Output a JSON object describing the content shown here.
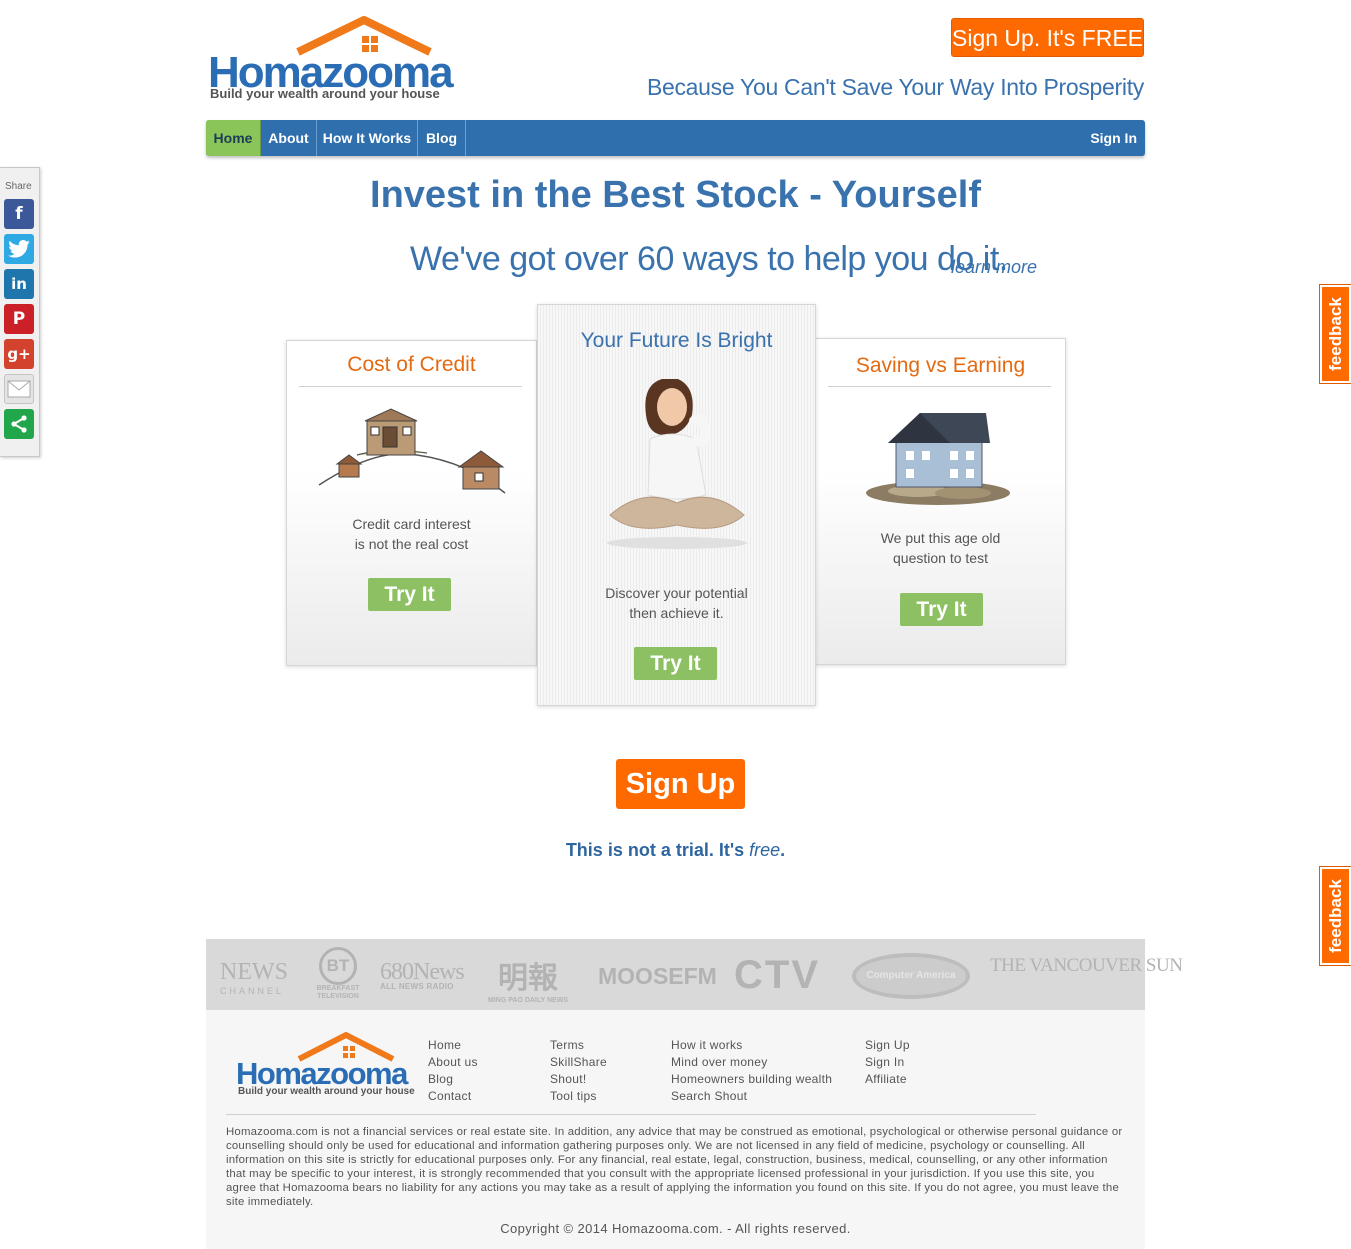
{
  "header": {
    "logo_word": "Homazooma",
    "logo_tagline": "Build your wealth around your house",
    "signup_label": "Sign Up. It's FREE",
    "tagline": "Because You Can't Save Your Way Into Prosperity"
  },
  "nav": {
    "items": [
      "Home",
      "About",
      "How It Works",
      "Blog"
    ],
    "active": "Home",
    "signin": "Sign In"
  },
  "share": {
    "label": "Share",
    "buttons": [
      {
        "name": "facebook",
        "glyph": "f",
        "color": "#3b5998"
      },
      {
        "name": "twitter",
        "glyph": "t",
        "color": "#2fa9e3"
      },
      {
        "name": "linkedin",
        "glyph": "in",
        "color": "#1f76ad"
      },
      {
        "name": "pinterest",
        "glyph": "P",
        "color": "#cb2027"
      },
      {
        "name": "google-plus",
        "glyph": "g+",
        "color": "#d2422c"
      },
      {
        "name": "email",
        "glyph": "✉",
        "color": "#c8c8c8"
      },
      {
        "name": "share-more",
        "glyph": "<",
        "color": "#22a64b"
      }
    ]
  },
  "feedback": {
    "label": "feedback"
  },
  "hero": {
    "title": "Invest in the Best Stock - Yourself",
    "subtitle": "We've got over 60 ways to help you do it.",
    "learn_more": "learn more"
  },
  "cards": {
    "left": {
      "title": "Cost of Credit",
      "line1": "Credit card interest",
      "line2": "is not the real cost",
      "button": "Try It",
      "icon": "houses-hill-illustration"
    },
    "center": {
      "title": "Your Future Is Bright",
      "line1": "Discover your potential",
      "line2": "then achieve it.",
      "button": "Try It",
      "icon": "woman-thinking-photo"
    },
    "right": {
      "title": "Saving vs Earning",
      "line1": "We put this age old",
      "line2": "question to test",
      "button": "Try It",
      "icon": "house-on-coins-photo"
    }
  },
  "signup": {
    "button": "Sign Up",
    "note_main": "This is not a trial. It's ",
    "note_em": "free",
    "note_end": "."
  },
  "media": {
    "logos": [
      "NEWS",
      "CHANNEL",
      "BT",
      "BREAKFAST TELEVISION",
      "680News",
      "ALL NEWS RADIO",
      "明報",
      "MING PAO DAILY NEWS",
      "MOOSEFM",
      "CTV",
      "Computer America",
      "THE VANCOUVER SUN"
    ]
  },
  "footer": {
    "logo_word": "Homazooma",
    "logo_tagline": "Build your wealth around your house",
    "col1": [
      "Home",
      "About us",
      "Blog",
      "Contact"
    ],
    "col2": [
      "Terms",
      "SkillShare",
      "Shout!",
      "Tool tips"
    ],
    "col3": [
      "How it works",
      "Mind over money",
      "Homeowners building wealth",
      "Search Shout"
    ],
    "col4": [
      "Sign Up",
      "Sign In",
      "Affiliate"
    ],
    "disclaimer": "Homazooma.com is not a financial services or real estate site. In addition, any advice that may be construed as emotional, psychological or otherwise personal guidance or counselling should only be used for educational and information gathering purposes only. We are not licensed in any field of medicine, psychology or counselling. All information on this site is strictly for educational purposes only. For any financial, real estate, legal, construction, business, medical, counselling, or any other information that may be specific to your interest, it is strongly recommended that you consult with the appropriate licensed professional in your jurisdiction. If you use this site, you agree that Homazooma bears no liability for any actions you may take as a result of applying the information you found on this site. If you do not agree, you must leave the site immediately.",
    "copyright": "Copyright © 2014 Homazooma.com. - All rights reserved."
  }
}
